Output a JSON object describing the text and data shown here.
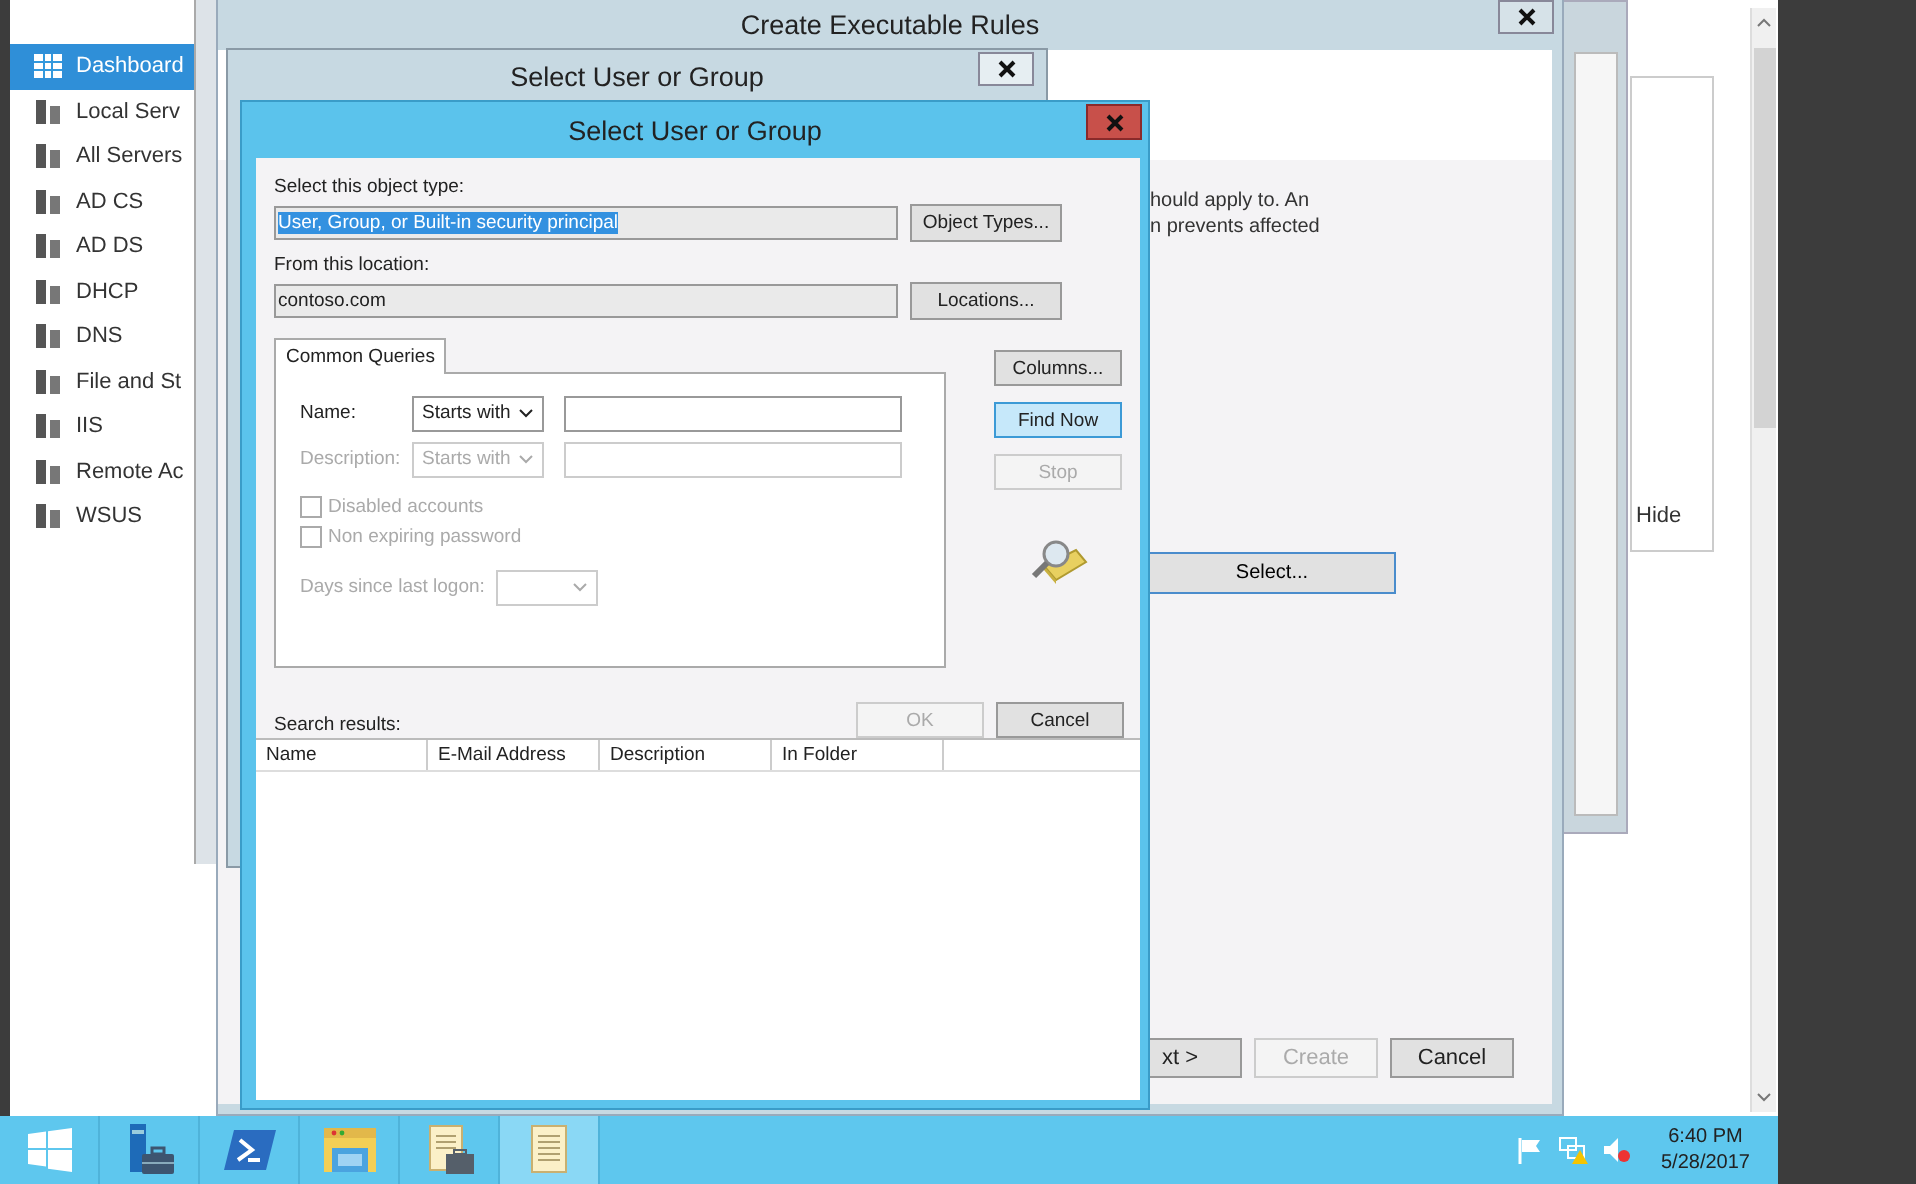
{
  "sidebar": {
    "items": [
      {
        "label": "Dashboard",
        "selected": true
      },
      {
        "label": "Local Serv",
        "selected": false
      },
      {
        "label": "All Servers",
        "selected": false
      },
      {
        "label": "AD CS",
        "selected": false
      },
      {
        "label": "AD DS",
        "selected": false
      },
      {
        "label": "DHCP",
        "selected": false
      },
      {
        "label": "DNS",
        "selected": false
      },
      {
        "label": "File and St",
        "selected": false
      },
      {
        "label": "IIS",
        "selected": false
      },
      {
        "label": "Remote Ac",
        "selected": false
      },
      {
        "label": "WSUS",
        "selected": false
      }
    ]
  },
  "background_window": {
    "option_label": "Hide"
  },
  "wizard": {
    "title": "Create Executable Rules",
    "description_lines": [
      "hould apply to. An",
      "n prevents affected"
    ],
    "select_button": "Select...",
    "footer_buttons": [
      {
        "label": "xt >",
        "disabled": false
      },
      {
        "label": "Create",
        "disabled": true
      },
      {
        "label": "Cancel",
        "disabled": false
      }
    ]
  },
  "back_dialog": {
    "title": "Select User or Group"
  },
  "dialog": {
    "title": "Select User or Group",
    "object_type": {
      "label": "Select this object type:",
      "value": "User, Group, or Built-in security principal",
      "value_selected": true,
      "button": "Object Types..."
    },
    "location": {
      "label": "From this location:",
      "value": "contoso.com",
      "button": "Locations..."
    },
    "tab": {
      "label": "Common Queries",
      "selected": true
    },
    "queries": [
      {
        "label": "Name:",
        "operator": "Starts with",
        "disabled": false
      },
      {
        "label": "Description:",
        "operator": "Starts with",
        "disabled": true
      }
    ],
    "checkboxes": [
      {
        "label": "Disabled accounts",
        "checked": false,
        "disabled": true
      },
      {
        "label": "Non expiring password",
        "checked": false,
        "disabled": true
      }
    ],
    "days": {
      "label": "Days since last logon:",
      "disabled": true
    },
    "side_buttons": [
      {
        "label": "Columns...",
        "disabled": false,
        "default": false
      },
      {
        "label": "Find Now",
        "disabled": false,
        "default": true
      },
      {
        "label": "Stop",
        "disabled": true,
        "default": false
      }
    ],
    "ok_button": {
      "label": "OK",
      "disabled": true
    },
    "cancel_button": {
      "label": "Cancel",
      "disabled": false
    },
    "results_label": "Search results:",
    "columns": [
      "Name",
      "E-Mail Address",
      "Description",
      "In Folder"
    ]
  },
  "taskbar": {
    "apps": [
      {
        "kind": "start",
        "selected": false
      },
      {
        "kind": "server-manager",
        "selected": false
      },
      {
        "kind": "powershell",
        "selected": false
      },
      {
        "kind": "explorer",
        "selected": false
      },
      {
        "kind": "document-tool",
        "selected": false
      },
      {
        "kind": "document",
        "selected": true
      }
    ],
    "time": "6:40 PM",
    "date": "5/28/2017"
  }
}
